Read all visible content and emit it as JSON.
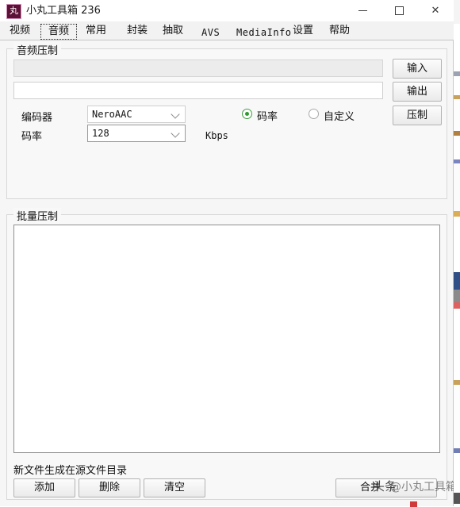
{
  "window": {
    "title": "小丸工具箱 236",
    "icon_glyph": "丸",
    "icon_name": "app-icon",
    "minimize_label": "",
    "maximize_label": "",
    "close_label": "✕",
    "accent_icon_bg": "#5d1137"
  },
  "tabs": [
    {
      "label": "视频",
      "selected": false,
      "mono": false
    },
    {
      "label": "音频",
      "selected": true,
      "mono": false
    },
    {
      "label": "常用",
      "selected": false,
      "mono": false
    },
    {
      "label": "封装",
      "selected": false,
      "mono": false
    },
    {
      "label": "抽取",
      "selected": false,
      "mono": false
    },
    {
      "label": "AVS",
      "selected": false,
      "mono": true
    },
    {
      "label": "MediaInfo",
      "selected": false,
      "mono": true
    },
    {
      "label": "设置",
      "selected": false,
      "mono": false
    },
    {
      "label": "帮助",
      "selected": false,
      "mono": false
    }
  ],
  "audio_group": {
    "title": "音频压制",
    "source_input": {
      "value": "",
      "placeholder": ""
    },
    "output_input": {
      "value": "",
      "placeholder": ""
    },
    "encoder_label": "编码器",
    "encoder_value": "NeroAAC",
    "bitrate_label": "码率",
    "bitrate_value": "128",
    "bitrate_unit": "Kbps",
    "mode_bitrate": {
      "label": "码率",
      "selected": true
    },
    "mode_custom": {
      "label": "自定义",
      "selected": false
    },
    "buttons": {
      "input": "输入",
      "output": "输出",
      "encode": "压制"
    }
  },
  "batch_group": {
    "title": "批量压制",
    "list_items": [],
    "note": "新文件生成在源文件目录",
    "buttons": {
      "add": "添加",
      "delete": "删除",
      "clear": "清空",
      "merge": "合并"
    }
  },
  "watermark": {
    "text": "头条",
    "overlay_text": "@小丸工具箱"
  }
}
